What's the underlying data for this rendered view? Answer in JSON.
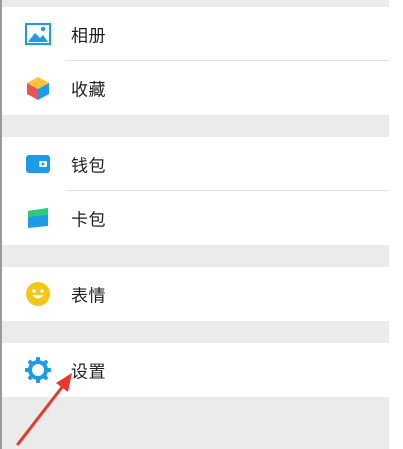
{
  "groups": [
    {
      "items": [
        {
          "label": "相册",
          "icon": "photo-album-icon"
        },
        {
          "label": "收藏",
          "icon": "favorites-cube-icon"
        }
      ]
    },
    {
      "items": [
        {
          "label": "钱包",
          "icon": "wallet-icon"
        },
        {
          "label": "卡包",
          "icon": "card-pack-icon"
        }
      ]
    },
    {
      "items": [
        {
          "label": "表情",
          "icon": "smiley-icon"
        }
      ]
    },
    {
      "items": [
        {
          "label": "设置",
          "icon": "settings-gear-icon"
        }
      ]
    }
  ],
  "annotation": {
    "arrow_color": "#e8382b",
    "target": "settings"
  },
  "colors": {
    "accent_blue": "#1e9be8",
    "smiley_yellow": "#f5c518",
    "arrow_red": "#e8382b"
  }
}
